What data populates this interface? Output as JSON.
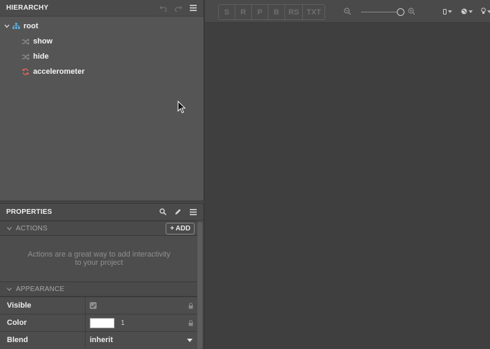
{
  "hierarchy": {
    "title": "HIERARCHY",
    "icons": [
      "undo-icon",
      "redo-icon",
      "menu-icon"
    ],
    "items": [
      {
        "label": "root",
        "icon": "hierarchy-icon",
        "expanded": true
      },
      {
        "label": "show",
        "icon": "shuffle-icon"
      },
      {
        "label": "hide",
        "icon": "shuffle-icon"
      },
      {
        "label": "accelerometer",
        "icon": "refresh-icon",
        "icon_color": "#e0685c"
      }
    ]
  },
  "properties": {
    "title": "PROPERTIES",
    "icons": [
      "search-icon",
      "pencil-icon",
      "menu-icon"
    ],
    "actions": {
      "header": "ACTIONS",
      "add_label": "ADD",
      "empty_text": "Actions are a great way to add interactivity to your project"
    },
    "appearance": {
      "header": "APPEARANCE",
      "rows": [
        {
          "label": "Visible",
          "checked": true
        },
        {
          "label": "Color",
          "color": "#ffffff",
          "alpha": "1"
        },
        {
          "label": "Blend",
          "value": "inherit"
        }
      ]
    }
  },
  "toolbar": {
    "gizmo_buttons": [
      "S",
      "R",
      "P",
      "B",
      "RS",
      "TXT"
    ],
    "zoom_level": 1.0
  },
  "colors": {
    "panel_bg": "#555555",
    "viewport_bg": "#3f3f3f",
    "hierarchy_icon": "#5aa6d6",
    "trigger_icon": "#e0685c"
  }
}
